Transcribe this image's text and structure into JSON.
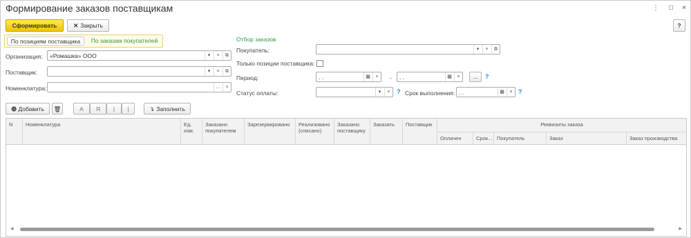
{
  "window": {
    "title": "Формирование заказов поставщикам",
    "controls": {
      "more": "⋮",
      "restore": "□",
      "close": "×"
    }
  },
  "toolbar": {
    "form_label": "Сформировать",
    "close_label": "Закрыть",
    "help_label": "?"
  },
  "tabs": [
    {
      "label": "По позициям поставщика"
    },
    {
      "label": "По заказам покупателей"
    }
  ],
  "left_form": {
    "organization": {
      "label": "Организация:",
      "value": "«Ромашка» ООО"
    },
    "supplier": {
      "label": "Поставщик:",
      "value": ""
    },
    "nomenclature": {
      "label": "Номенклатура:",
      "value": ""
    }
  },
  "filter": {
    "section_title": "Отбор заказов",
    "buyer": {
      "label": "Покупатель:",
      "value": ""
    },
    "only_supplier": {
      "label": "Только позиции поставщика:"
    },
    "period": {
      "label": "Период:",
      "from": " .  .",
      "dash": "-",
      "to": " .  .",
      "more": "..."
    },
    "payment_status": {
      "label": "Статус оплаты:",
      "value": ""
    },
    "due_date": {
      "label": "Срок выполнения:",
      "value": " .  ."
    }
  },
  "table_toolbar": {
    "add_label": "Добавить",
    "fill_label": "Заполнить",
    "fmt_a": "A",
    "fmt_ya": "Я",
    "fmt_up": "|",
    "fmt_down": "|"
  },
  "table": {
    "columns": [
      "N",
      "Номенклатура",
      "Ед. изм.",
      "Заказано покупателем",
      "Зарезервировано",
      "Реализовано (списано)",
      "Заказано поставщику",
      "Заказать",
      "Поставщик",
      "Реквизиты заказа"
    ],
    "subcolumns": [
      "Оплачен",
      "Срок...",
      "Покупатель",
      "Заказ",
      "Заказ производства"
    ]
  }
}
